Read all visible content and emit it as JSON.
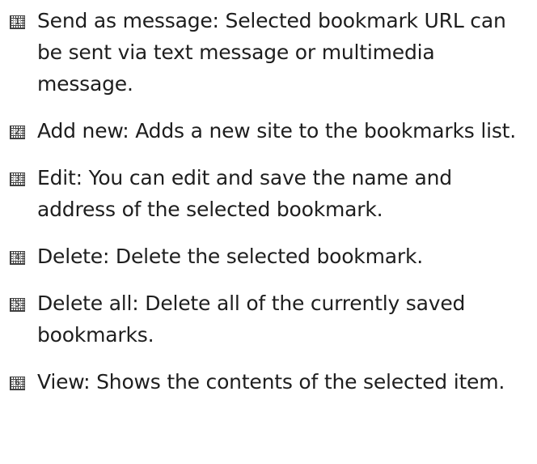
{
  "items": [
    {
      "number": "1",
      "text": "Send as message: Selected bookmark URL can be sent via text message or multimedia message."
    },
    {
      "number": "2",
      "text": "Add new: Adds a new site to the bookmarks list."
    },
    {
      "number": "3",
      "text": "Edit: You can edit and save the name and address of the selected bookmark."
    },
    {
      "number": "4",
      "text": "Delete: Delete the selected bookmark."
    },
    {
      "number": "5",
      "text": "Delete all: Delete all of the currently saved bookmarks."
    },
    {
      "number": "6",
      "text": "View: Shows the contents of the selected item."
    }
  ]
}
